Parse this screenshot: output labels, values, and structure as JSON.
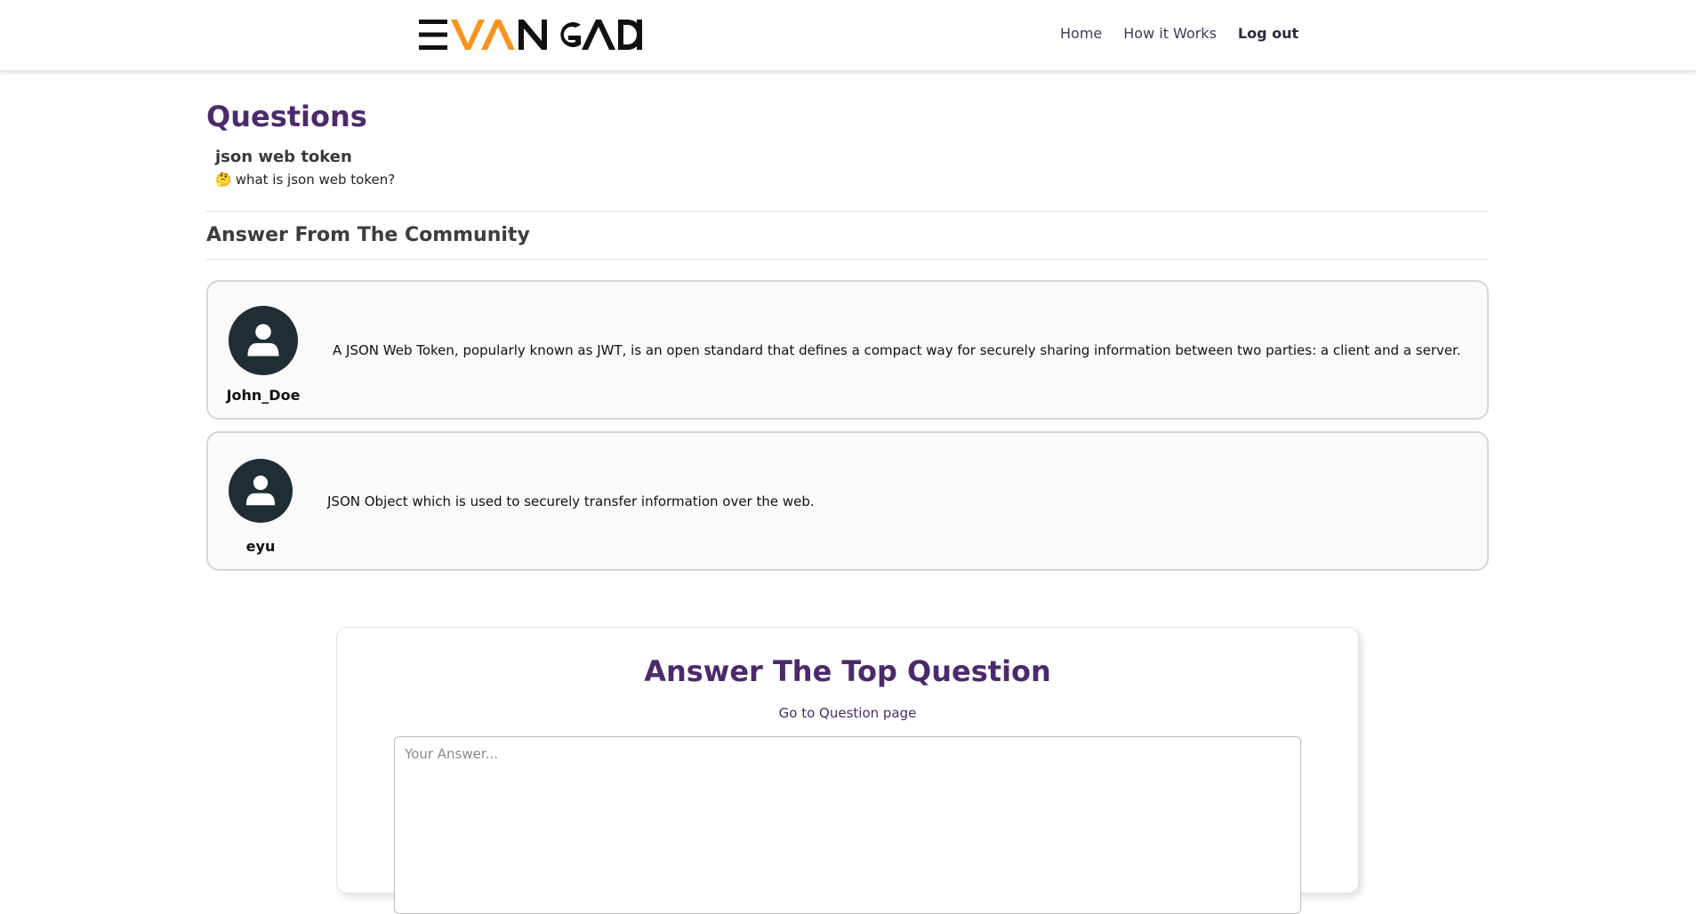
{
  "header": {
    "logo_text": "EVANGADI",
    "logo_accent_color": "#f7931e",
    "nav": {
      "home": "Home",
      "how_it_works": "How it Works",
      "logout": "Log out"
    }
  },
  "page": {
    "questions_title": "Questions",
    "question": {
      "title": "json web token",
      "emoji": "🤔",
      "description": "what is json web token?"
    },
    "community_title": "Answer From The Community",
    "answers": [
      {
        "username": "John_Doe",
        "text": "A JSON Web Token, popularly known as JWT, is an open standard that defines a compact way for securely sharing information between two parties: a client and a server.",
        "avatar_icon": "user-avatar-icon"
      },
      {
        "username": "eyu",
        "text": "JSON Object which is used to securely transfer information over the web.",
        "avatar_icon": "user-avatar-icon"
      }
    ]
  },
  "answer_form": {
    "title": "Answer The Top Question",
    "goto_link": "Go to Question page",
    "placeholder": "Your Answer..."
  },
  "colors": {
    "brand_purple": "#4b2a6b",
    "avatar_bg": "#1f2d35"
  }
}
